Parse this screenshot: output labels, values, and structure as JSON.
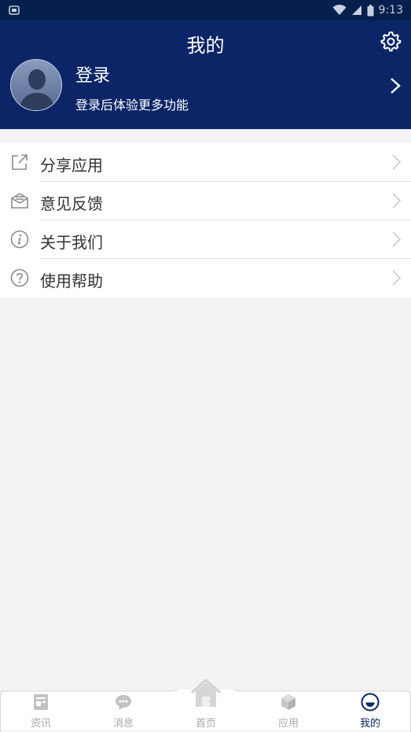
{
  "status_bar": {
    "time": "9:13"
  },
  "header": {
    "title": "我的",
    "login_title": "登录",
    "login_subtitle": "登录后体验更多功能"
  },
  "menu": {
    "items": [
      {
        "label": "分享应用",
        "icon": "share-icon"
      },
      {
        "label": "意见反馈",
        "icon": "feedback-icon"
      },
      {
        "label": "关于我们",
        "icon": "info-icon"
      },
      {
        "label": "使用帮助",
        "icon": "help-icon"
      }
    ]
  },
  "tabbar": {
    "items": [
      {
        "label": "资讯",
        "icon": "news-icon",
        "active": false
      },
      {
        "label": "消息",
        "icon": "message-icon",
        "active": false
      },
      {
        "label": "首页",
        "icon": "home-icon",
        "active": false
      },
      {
        "label": "应用",
        "icon": "apps-icon",
        "active": false
      },
      {
        "label": "我的",
        "icon": "profile-icon",
        "active": true
      }
    ]
  },
  "colors": {
    "header_bg": "#0b2567",
    "status_bar_bg": "#071f4c",
    "page_bg": "#f3f3f3",
    "active_tab": "#0b2567",
    "inactive_tab": "#a8a8a8"
  }
}
